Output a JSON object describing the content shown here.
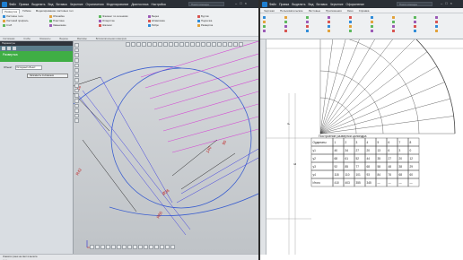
{
  "left": {
    "title_logo": "kompas-logo-icon",
    "menu": [
      "Файл",
      "Правка",
      "Выделить",
      "Вид",
      "Вставка",
      "Черчение",
      "Ограничения",
      "Моделирование",
      "Диагностика",
      "Настройка"
    ],
    "search_placeholder": "Поиск команды",
    "tabs": [
      "Развертка",
      "Гибкие",
      "Моделирование листовых тел"
    ],
    "active_tab_index": 0,
    "ribbon_items": [
      [
        "Листовое тело",
        "Листовой профиль",
        "Сгиб"
      ],
      [
        "Обечайка",
        "Пластина",
        "Замыкание"
      ],
      [
        "Элемент по сечениям",
        "Отверстие",
        "Жалюзи"
      ],
      [
        "Вырез",
        "Штамповка",
        "Ребро"
      ],
      [
        "Буртик",
        "Подсечка",
        "Развертка"
      ]
    ],
    "ribbon_strip": [
      "Системная",
      "Сгибы",
      "Элементы",
      "Вырезы",
      "Массивы",
      "Вспомогательная геометрия"
    ],
    "panel": {
      "header": "Параметры",
      "green_title": "Развертка",
      "object_label": "Объект",
      "object_value": "Исходный объект",
      "save_button": "Запомнить положение"
    },
    "status_lines": [
      "Укажите грани на свет в вылета",
      "... ..."
    ],
    "dim_labels": [
      "16",
      "R42",
      "R60",
      "Ø36",
      "140",
      "90"
    ]
  },
  "right": {
    "menu": [
      "Файл",
      "Правка",
      "Выделить",
      "Вид",
      "Вставка",
      "Черчение",
      "Оформление"
    ],
    "search_placeholder": "Поиск команды",
    "tabs": [
      "Чертежи",
      "Пользовательские",
      "Листовые",
      "Приложения",
      "Окно",
      "Справка"
    ],
    "table_title": "Построение развертки цилиндра",
    "table_headers": [
      "Ординаты",
      "1",
      "2",
      "3",
      "4",
      "5",
      "6",
      "7",
      "8"
    ],
    "table_rows": [
      [
        "y1",
        "40",
        "34",
        "27",
        "20",
        "13",
        "6",
        "3",
        "0"
      ],
      [
        "y2",
        "68",
        "61",
        "52",
        "44",
        "35",
        "27",
        "20",
        "12"
      ],
      [
        "y3",
        "92",
        "85",
        "77",
        "68",
        "58",
        "48",
        "38",
        "29"
      ],
      [
        "y4",
        "118",
        "110",
        "101",
        "93",
        "84",
        "76",
        "68",
        "60"
      ],
      [
        "Итого",
        "410",
        "403",
        "355",
        "345",
        "—",
        "—",
        "—",
        "—"
      ]
    ],
    "side_labels": [
      "Р",
      "Б"
    ]
  }
}
